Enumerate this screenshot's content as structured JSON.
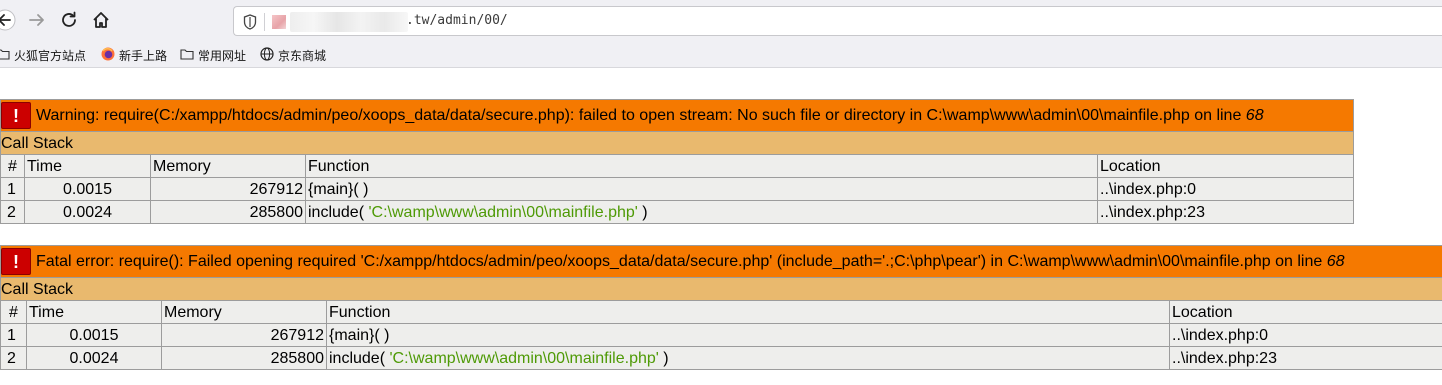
{
  "browser": {
    "url_suffix": ".tw/admin/00/",
    "bookmarks": [
      {
        "label": "火狐官方站点",
        "icon": "folder-icon"
      },
      {
        "label": "新手上路",
        "icon": "firefox-icon"
      },
      {
        "label": "常用网址",
        "icon": "folder-icon"
      },
      {
        "label": "京东商城",
        "icon": "globe-icon"
      }
    ]
  },
  "errors": [
    {
      "badge": "( ! )",
      "message": "Warning: require(C:/xampp/htdocs/admin/peo/xoops_data/data/secure.php): failed to open stream: No such file or directory in C:\\wamp\\www\\admin\\00\\mainfile.php on line ",
      "line": "68",
      "call_stack_label": "Call Stack",
      "columns": {
        "num": "#",
        "time": "Time",
        "memory": "Memory",
        "function": "Function",
        "location": "Location"
      },
      "rows": [
        {
          "num": "1",
          "time": "0.0015",
          "memory": "267912",
          "function": "{main}( )",
          "arg": "",
          "fn_close": "",
          "location": "..\\index.php:0"
        },
        {
          "num": "2",
          "time": "0.0024",
          "memory": "285800",
          "function": "include( ",
          "arg": "'C:\\wamp\\www\\admin\\00\\mainfile.php'",
          "fn_close": " )",
          "location": "..\\index.php:23"
        }
      ]
    },
    {
      "badge": "( ! )",
      "message": "Fatal error: require(): Failed opening required 'C:/xampp/htdocs/admin/peo/xoops_data/data/secure.php' (include_path='.;C:\\php\\pear') in C:\\wamp\\www\\admin\\00\\mainfile.php on line ",
      "line": "68",
      "call_stack_label": "Call Stack",
      "columns": {
        "num": "#",
        "time": "Time",
        "memory": "Memory",
        "function": "Function",
        "location": "Location"
      },
      "rows": [
        {
          "num": "1",
          "time": "0.0015",
          "memory": "267912",
          "function": "{main}( )",
          "arg": "",
          "fn_close": "",
          "location": "..\\index.php:0"
        },
        {
          "num": "2",
          "time": "0.0024",
          "memory": "285800",
          "function": "include( ",
          "arg": "'C:\\wamp\\www\\admin\\00\\mainfile.php'",
          "fn_close": " )",
          "location": "..\\index.php:23"
        }
      ]
    }
  ],
  "colors": {
    "error_header": "#f57900",
    "call_stack_header": "#e9b96e",
    "row_bg": "#eeeeec",
    "function_arg": "#4e9a06",
    "badge": "#cc0000"
  }
}
